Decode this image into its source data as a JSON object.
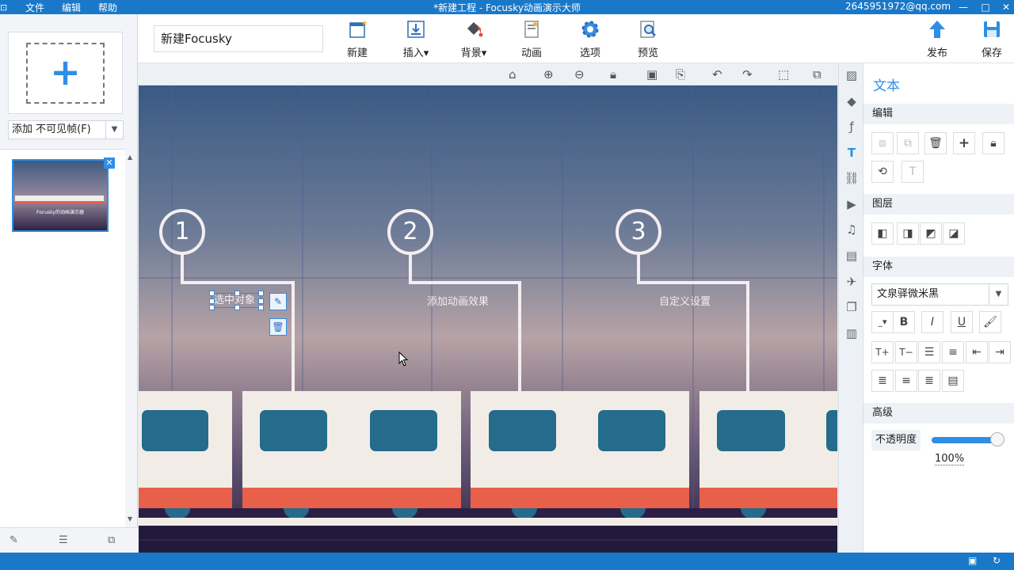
{
  "titlebar": {
    "menu_items": [
      "文件",
      "编辑",
      "帮助"
    ],
    "window_title": "*新建工程 - Focusky动画演示大师",
    "user_email": "2645951972@qq.com"
  },
  "leftpanel": {
    "add_select_value": "添加 不可见帧(F)",
    "slide_thumbnail_caption": "Focusky的动画演示器"
  },
  "toolbar": {
    "project_title": "新建Focusky",
    "buttons": {
      "new": "新建",
      "insert": "插入",
      "background": "背景",
      "animation": "动画",
      "options": "选项",
      "preview": "预览",
      "publish": "发布",
      "save": "保存"
    },
    "dropdown_glyph": "▾"
  },
  "canvas": {
    "steps": [
      {
        "number": "1",
        "label": "选中对象"
      },
      {
        "number": "2",
        "label": "添加动画效果"
      },
      {
        "number": "3",
        "label": "自定义设置"
      }
    ],
    "colors": {
      "train_body": "#f1ede6",
      "train_window": "#256b8c",
      "train_stripe": "#e8604a",
      "line": "#f4eef0"
    }
  },
  "rightpanel": {
    "title": "文本",
    "sections": {
      "edit": "编辑",
      "layer": "图层",
      "font": "字体",
      "advanced": "高级"
    },
    "font_family_value": "文泉驿微米黑",
    "format_buttons": {
      "bold": "B",
      "italic": "I",
      "underline": "U",
      "text_glyph": "T"
    },
    "opacity_label": "不透明度",
    "opacity_value": "100%",
    "opacity_fraction": 1.0
  },
  "accent_color": "#2f8ee6",
  "titlebar_color": "#1a78c8"
}
